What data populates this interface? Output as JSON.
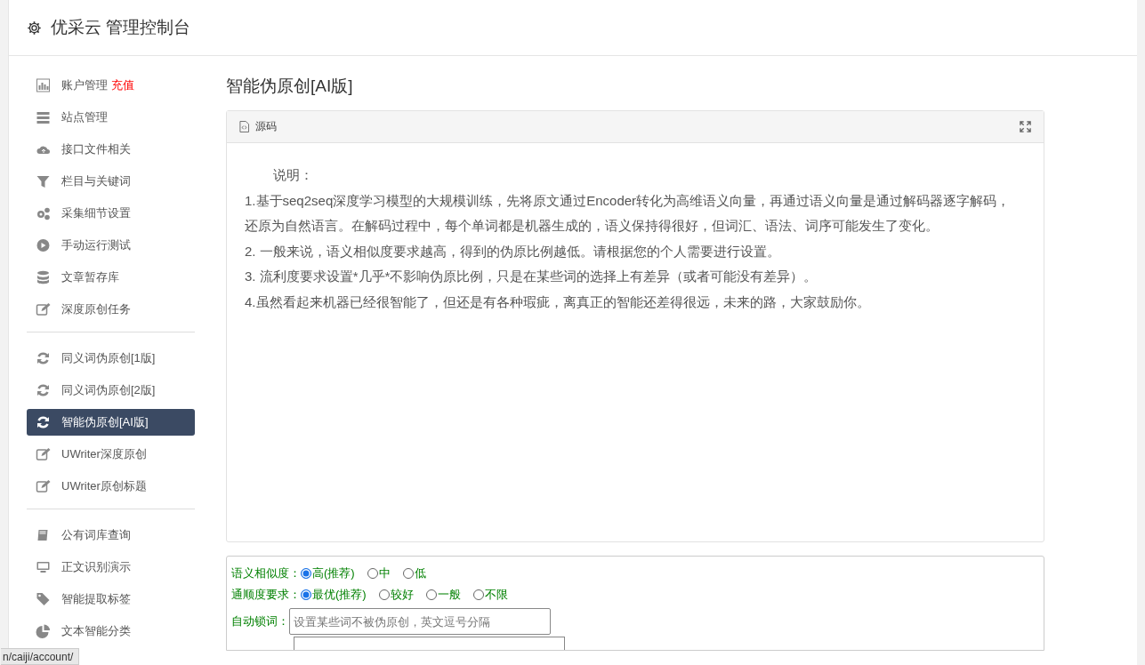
{
  "header": {
    "title": "优采云 管理控制台"
  },
  "sidebar": {
    "groups": [
      [
        {
          "label": "账户管理",
          "badge": "充值",
          "selected": false
        },
        {
          "label": "站点管理",
          "selected": false
        },
        {
          "label": "接口文件相关",
          "selected": false
        },
        {
          "label": "栏目与关键词",
          "selected": false
        },
        {
          "label": "采集细节设置",
          "selected": false
        },
        {
          "label": "手动运行测试",
          "selected": false
        },
        {
          "label": "文章暂存库",
          "selected": false
        },
        {
          "label": "深度原创任务",
          "selected": false
        }
      ],
      [
        {
          "label": "同义词伪原创[1版]",
          "selected": false
        },
        {
          "label": "同义词伪原创[2版]",
          "selected": false
        },
        {
          "label": "智能伪原创[AI版]",
          "selected": true
        },
        {
          "label": "UWriter深度原创",
          "selected": false
        },
        {
          "label": "UWriter原创标题",
          "selected": false
        }
      ],
      [
        {
          "label": "公有词库查询",
          "selected": false
        },
        {
          "label": "正文识别演示",
          "selected": false
        },
        {
          "label": "智能提取标签",
          "selected": false
        },
        {
          "label": "文本智能分类",
          "selected": false
        }
      ]
    ]
  },
  "content": {
    "title": "智能伪原创[AI版]",
    "panel": {
      "tab": "源码",
      "lines": [
        "说明：",
        "1.基于seq2seq深度学习模型的大规模训练，先将原文通过Encoder转化为高维语义向量，再通过语义向量是通过解码器逐字解码，还原为自然语言。在解码过程中，每个单词都是机器生成的，语义保持得很好，但词汇、语法、词序可能发生了变化。",
        "2. 一般来说，语义相似度要求越高，得到的伪原比例越低。请根据您的个人需要进行设置。",
        "3. 流利度要求设置*几乎*不影响伪原比例，只是在某些词的选择上有差异（或者可能没有差异）。",
        "4.虽然看起来机器已经很智能了，但还是有各种瑕疵，离真正的智能还差得很远，未来的路，大家鼓励你。"
      ]
    },
    "options": [
      {
        "kind": "radio",
        "label": "语义相似度：",
        "choices": [
          {
            "label": "高(推荐)",
            "selected": true
          },
          {
            "label": "中",
            "selected": false
          },
          {
            "label": "低",
            "selected": false
          }
        ]
      },
      {
        "kind": "radio",
        "label": "通顺度要求：",
        "choices": [
          {
            "label": "最优(推荐)",
            "selected": true
          },
          {
            "label": "较好",
            "selected": false
          },
          {
            "label": "一般",
            "selected": false
          },
          {
            "label": "不限",
            "selected": false
          }
        ]
      },
      {
        "kind": "text",
        "label": "自动锁词：",
        "placeholder": "设置某些词不被伪原创，英文逗号分隔"
      },
      {
        "kind": "textarea"
      }
    ]
  },
  "status_bar": {
    "url": "n/caiji/account/"
  }
}
